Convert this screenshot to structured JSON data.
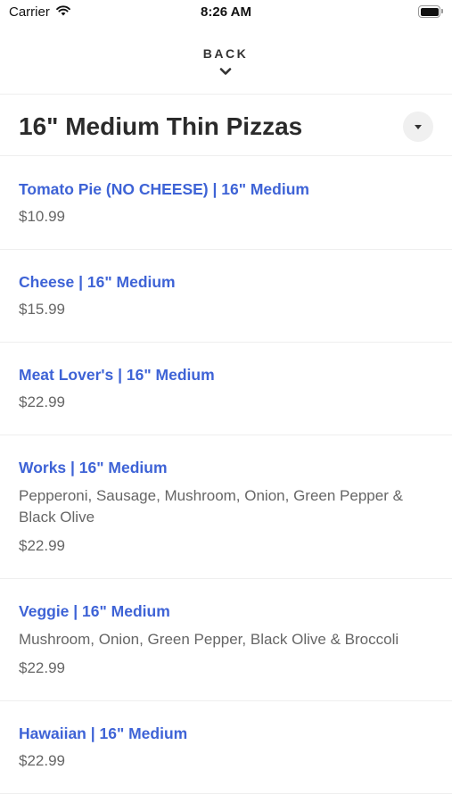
{
  "status_bar": {
    "carrier": "Carrier",
    "time": "8:26 AM",
    "icons": [
      "wifi-icon",
      "battery-icon"
    ]
  },
  "nav": {
    "back_label": "BACK",
    "back_icon": "chevron-down-icon"
  },
  "category": {
    "title": "16\" Medium Thin Pizzas",
    "dropdown_icon": "caret-down-icon"
  },
  "colors": {
    "item_name": "#3e63d6",
    "text_secondary": "#666666",
    "title": "#2b2b2b",
    "divider": "#eeeeee"
  },
  "menu": {
    "items": [
      {
        "name": "Tomato Pie (NO CHEESE) | 16\" Medium",
        "description": "",
        "price": "$10.99"
      },
      {
        "name": "Cheese | 16\" Medium",
        "description": "",
        "price": "$15.99"
      },
      {
        "name": "Meat Lover's | 16\" Medium",
        "description": "",
        "price": "$22.99"
      },
      {
        "name": "Works | 16\" Medium",
        "description": "Pepperoni, Sausage, Mushroom, Onion, Green Pepper & Black Olive",
        "price": "$22.99"
      },
      {
        "name": "Veggie | 16\" Medium",
        "description": "Mushroom, Onion, Green Pepper, Black Olive & Broccoli",
        "price": "$22.99"
      },
      {
        "name": "Hawaiian | 16\" Medium",
        "description": "",
        "price": "$22.99"
      }
    ]
  }
}
